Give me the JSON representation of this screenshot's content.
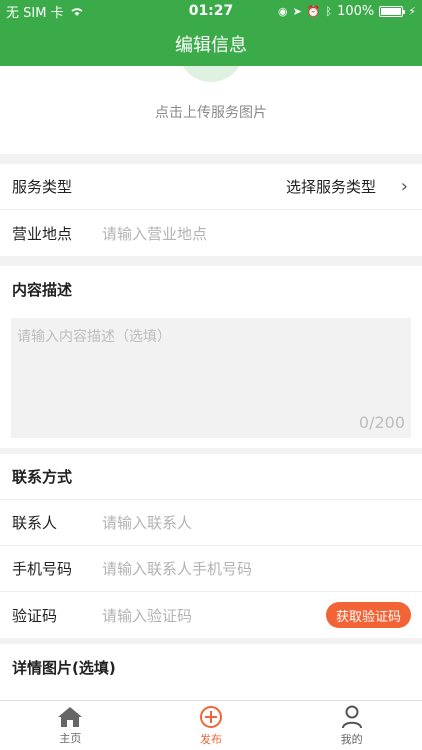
{
  "status_bar": {
    "carrier": "无 SIM 卡",
    "time": "01:27",
    "battery": "100%"
  },
  "nav": {
    "title": "编辑信息"
  },
  "upload": {
    "text": "点击上传服务图片"
  },
  "service": {
    "type_label": "服务类型",
    "type_value": "选择服务类型",
    "location_label": "营业地点",
    "location_placeholder": "请输入营业地点"
  },
  "description": {
    "heading": "内容描述",
    "placeholder": "请输入内容描述（选填）",
    "counter": "0/200"
  },
  "contact": {
    "heading": "联系方式",
    "person_label": "联系人",
    "person_placeholder": "请输入联系人",
    "phone_label": "手机号码",
    "phone_placeholder": "请输入联系人手机号码",
    "code_label": "验证码",
    "code_placeholder": "请输入验证码",
    "code_button": "获取验证码"
  },
  "details": {
    "heading": "详情图片(选填)"
  },
  "tabbar": {
    "tabs": [
      {
        "label": "主页",
        "icon": "home-icon"
      },
      {
        "label": "发布",
        "icon": "plus-circle-icon"
      },
      {
        "label": "我的",
        "icon": "user-icon"
      }
    ]
  },
  "colors": {
    "brand": "#3bab4a",
    "accent": "#f26436"
  }
}
